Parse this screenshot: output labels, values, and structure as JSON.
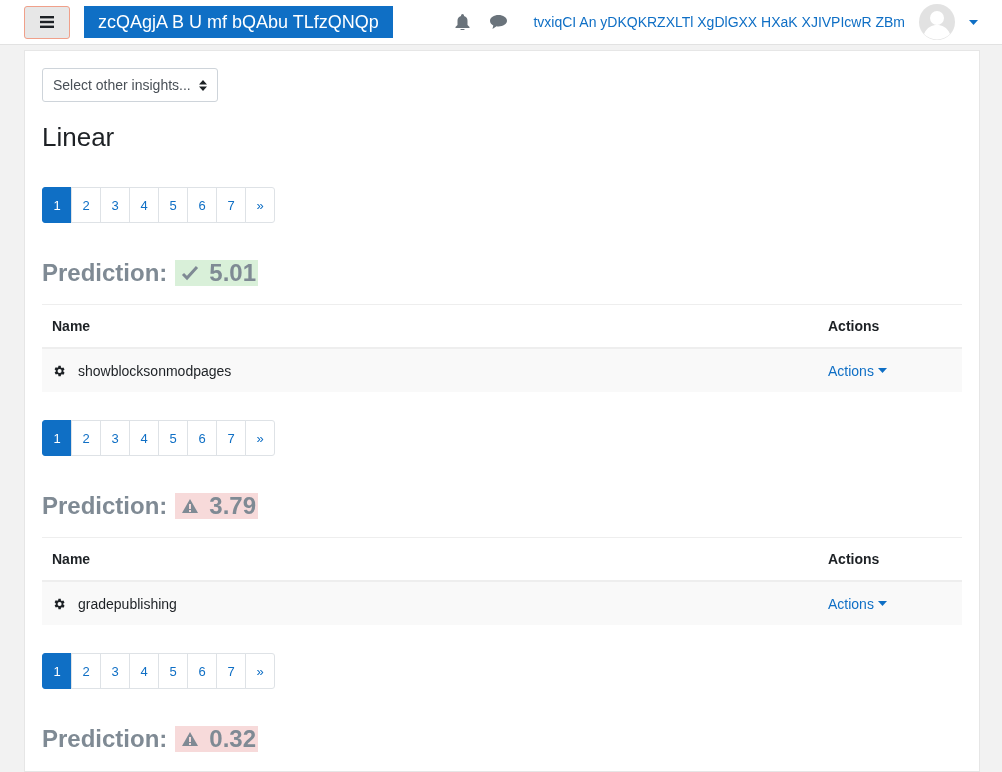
{
  "navbar": {
    "site_name": "zcQAgjA B U mf bQAbu TLfzQNQp",
    "user_name": "tvxiqCI An yDKQKRZXLTl XgDlGXX HXaK XJIVPIcwR ZBm"
  },
  "insight_select": {
    "value": "Select other insights..."
  },
  "heading": "Linear",
  "blocks": [
    {
      "kind": "pagination",
      "pages": [
        {
          "label": "1",
          "selected": true
        },
        {
          "label": "2",
          "selected": false
        },
        {
          "label": "3",
          "selected": false
        },
        {
          "label": "4",
          "selected": false
        },
        {
          "label": "5",
          "selected": false
        },
        {
          "label": "6",
          "selected": false
        },
        {
          "label": "7",
          "selected": false
        }
      ],
      "next": "»"
    },
    {
      "kind": "prediction",
      "label": "Prediction:",
      "badge": {
        "kind": "ok",
        "value": "5.01"
      },
      "table": {
        "columns": [
          "Name",
          "Actions"
        ],
        "rows": [
          {
            "name": "showblocksonmodpages",
            "action": "Actions"
          }
        ]
      }
    },
    {
      "kind": "pagination",
      "pages": [
        {
          "label": "1",
          "selected": true
        },
        {
          "label": "2",
          "selected": false
        },
        {
          "label": "3",
          "selected": false
        },
        {
          "label": "4",
          "selected": false
        },
        {
          "label": "5",
          "selected": false
        },
        {
          "label": "6",
          "selected": false
        },
        {
          "label": "7",
          "selected": false
        }
      ],
      "next": "»"
    },
    {
      "kind": "prediction",
      "label": "Prediction:",
      "badge": {
        "kind": "warning",
        "value": "3.79"
      },
      "table": {
        "columns": [
          "Name",
          "Actions"
        ],
        "rows": [
          {
            "name": "gradepublishing",
            "action": "Actions"
          }
        ]
      }
    },
    {
      "kind": "pagination",
      "pages": [
        {
          "label": "1",
          "selected": true
        },
        {
          "label": "2",
          "selected": false
        },
        {
          "label": "3",
          "selected": false
        },
        {
          "label": "4",
          "selected": false
        },
        {
          "label": "5",
          "selected": false
        },
        {
          "label": "6",
          "selected": false
        },
        {
          "label": "7",
          "selected": false
        }
      ],
      "next": "»"
    },
    {
      "kind": "prediction",
      "label": "Prediction:",
      "badge": {
        "kind": "warning",
        "value": "0.32"
      }
    }
  ]
}
